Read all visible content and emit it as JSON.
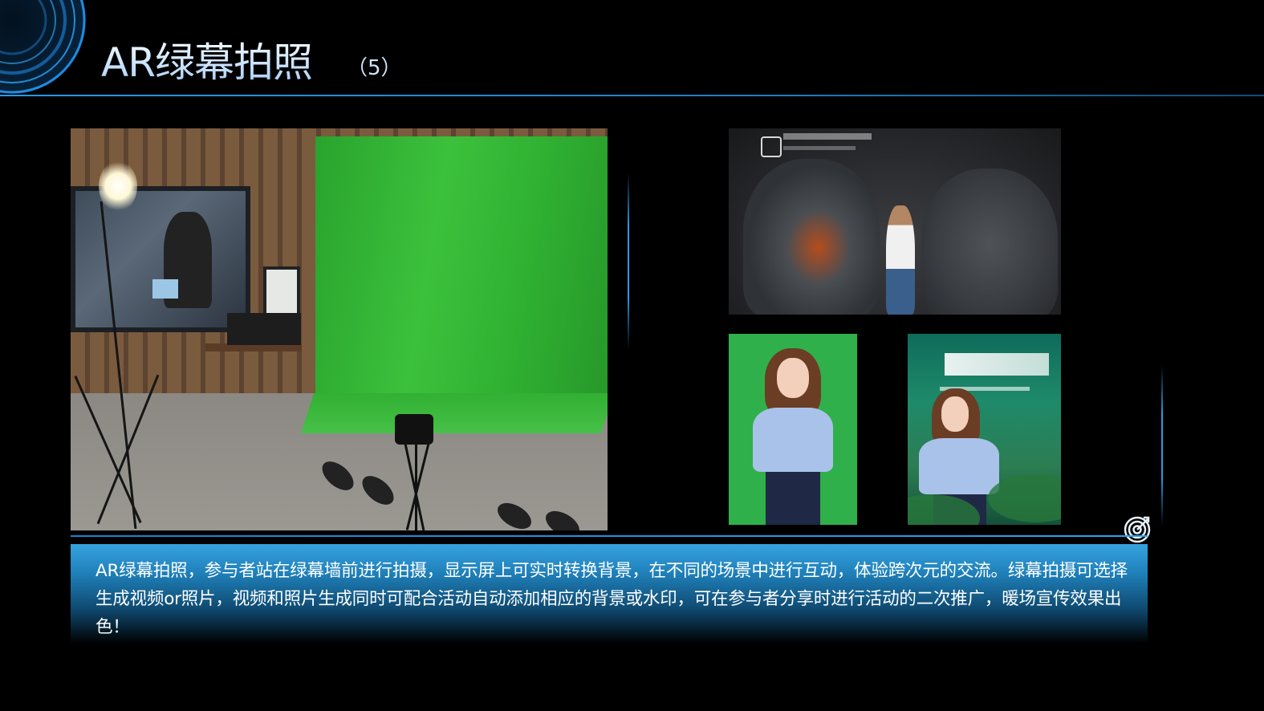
{
  "slide": {
    "title": "AR绿幕拍照",
    "title_suffix": "（5）",
    "description": "AR绿幕拍照，参与者站在绿幕墙前进行拍摄，显示屏上可实时转换背景，在不同的场景中进行互动，体验跨次元的交流。绿幕拍摄可选择生成视频or照片，视频和照片生成同时可配合活动自动添加相应的背景或水印，可在参与者分享时进行活动的二次推广，暖场宣传效果出色！"
  },
  "icons": {
    "decor": "concentric-rings-icon",
    "target": "target-icon"
  },
  "colors": {
    "accent": "#2a9ae6",
    "desc_box_top": "#35a3e0",
    "background": "#000000"
  }
}
